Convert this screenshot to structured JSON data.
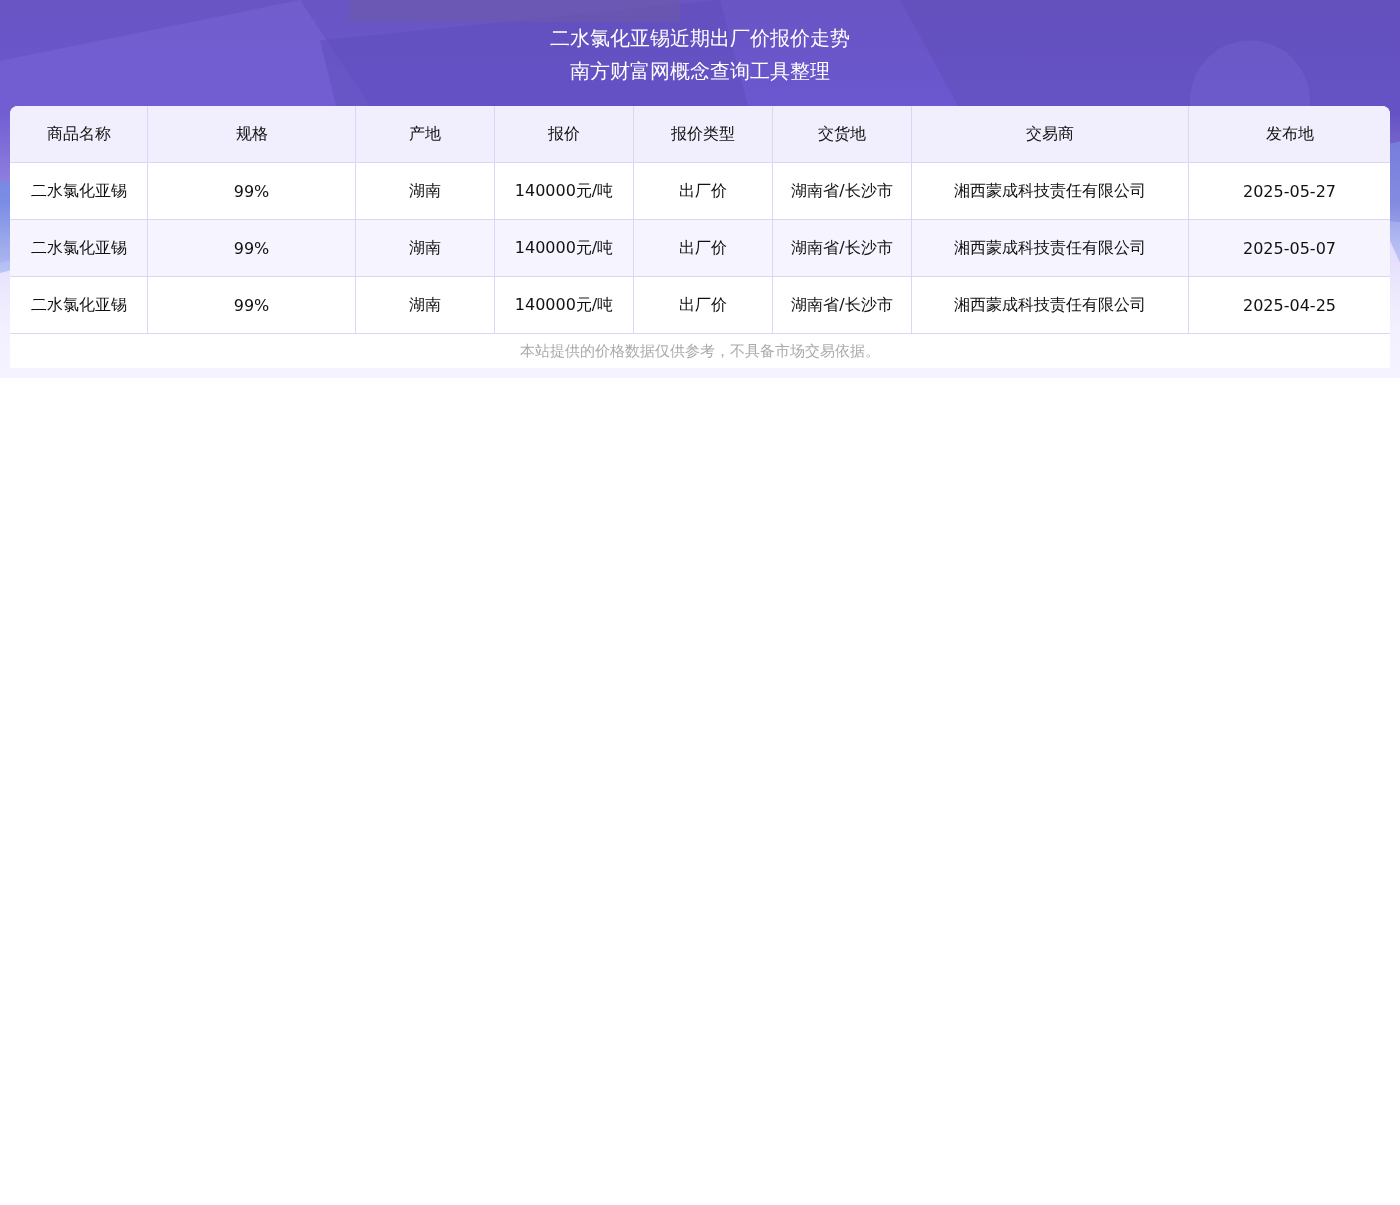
{
  "header": {
    "title": "二水氯化亚锡近期出厂价报价走势",
    "subtitle": "南方财富网概念查询工具整理"
  },
  "table": {
    "columns": [
      "商品名称",
      "规格",
      "产地",
      "报价",
      "报价类型",
      "交货地",
      "交易商",
      "发布地"
    ],
    "rows": [
      [
        "二水氯化亚锡",
        "99%",
        "湖南",
        "140000元/吨",
        "出厂价",
        "湖南省/长沙市",
        "湘西蒙成科技责任有限公司",
        "2025-05-27"
      ],
      [
        "二水氯化亚锡",
        "99%",
        "湖南",
        "140000元/吨",
        "出厂价",
        "湖南省/长沙市",
        "湘西蒙成科技责任有限公司",
        "2025-05-07"
      ],
      [
        "二水氯化亚锡",
        "99%",
        "湖南",
        "140000元/吨",
        "出厂价",
        "湖南省/长沙市",
        "湘西蒙成科技责任有限公司",
        "2025-04-25"
      ]
    ]
  },
  "disclaimer": "本站提供的价格数据仅供参考，不具备市场交易依据。"
}
